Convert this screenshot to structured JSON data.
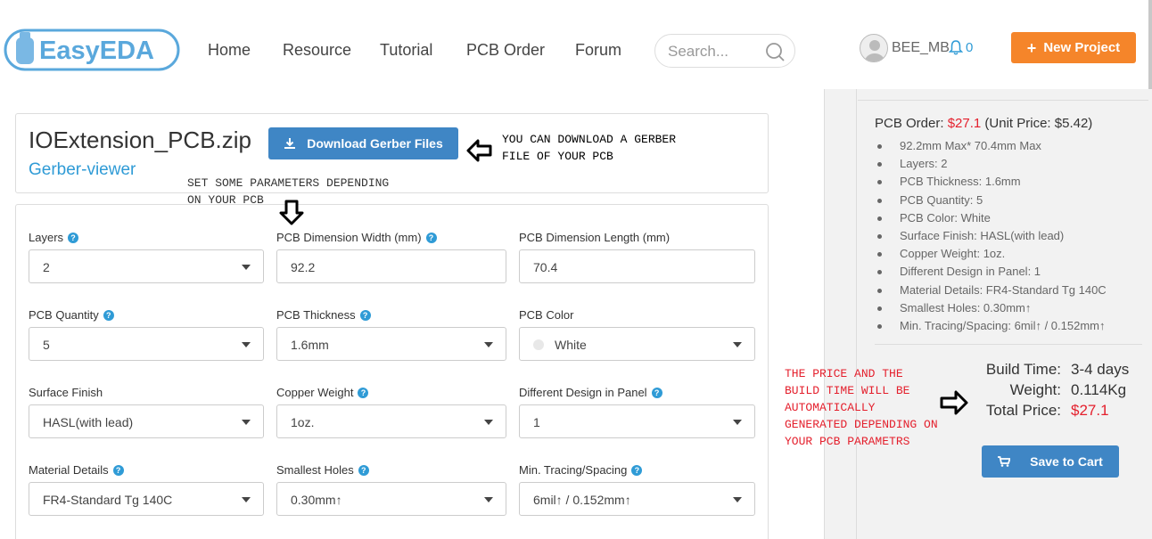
{
  "header": {
    "logo_text": "EasyEDA",
    "nav": [
      "Home",
      "Resource",
      "Tutorial",
      "PCB Order",
      "Forum"
    ],
    "search_placeholder": "Search...",
    "username": "BEE_MB",
    "notification_count": "0",
    "new_project_label": "New Project",
    "icons": [
      "search-icon",
      "bell-icon",
      "plus-icon",
      "avatar"
    ],
    "accent_color": "#f5852a",
    "brand_color": "#2f9bd6"
  },
  "file": {
    "title": "IOExtension_PCB.zip",
    "viewer_link": "Gerber-viewer",
    "download_label": "Download Gerber Files"
  },
  "annotations": {
    "download_note_1": "YOU CAN DOWNLOAD A GERBER",
    "download_note_2": "FILE OF YOUR PCB",
    "params_note_1": "SET SOME PARAMETERS DEPENDING",
    "params_note_2": "ON YOUR PCB",
    "price_note": [
      "THE PRICE AND THE",
      "BUILD TIME WILL BE",
      "AUTOMATICALLY",
      "GENERATED DEPENDING ON",
      "YOUR PCB PARAMETRS"
    ]
  },
  "form": {
    "fields": [
      {
        "label": "Layers",
        "value": "2",
        "help": true,
        "type": "select"
      },
      {
        "label": "PCB Dimension Width (mm)",
        "value": "92.2",
        "help": true,
        "type": "input"
      },
      {
        "label": "PCB Dimension Length (mm)",
        "value": "70.4",
        "help": false,
        "type": "input"
      },
      {
        "label": "PCB Quantity",
        "value": "5",
        "help": true,
        "type": "select"
      },
      {
        "label": "PCB Thickness",
        "value": "1.6mm",
        "help": true,
        "type": "select"
      },
      {
        "label": "PCB Color",
        "value": "White",
        "help": false,
        "type": "select"
      },
      {
        "label": "Surface Finish",
        "value": "HASL(with lead)",
        "help": false,
        "type": "select"
      },
      {
        "label": "Copper Weight",
        "value": "1oz.",
        "help": true,
        "type": "select"
      },
      {
        "label": "Different Design in Panel",
        "value": "1",
        "help": true,
        "type": "select"
      },
      {
        "label": "Material Details",
        "value": "FR4-Standard Tg 140C",
        "help": true,
        "type": "select"
      },
      {
        "label": "Smallest Holes",
        "value": "0.30mm↑",
        "help": true,
        "type": "select"
      },
      {
        "label": "Min. Tracing/Spacing",
        "value": "6mil↑ / 0.152mm↑",
        "help": true,
        "type": "select"
      }
    ]
  },
  "order": {
    "title_prefix": "PCB Order: ",
    "price": "$27.1",
    "unit_price": "(Unit Price: $5.42)",
    "specs": [
      "92.2mm Max* 70.4mm Max",
      "Layers: 2",
      "PCB Thickness: 1.6mm",
      "PCB Quantity: 5",
      "PCB Color: White",
      "Surface Finish: HASL(with lead)",
      "Copper Weight: 1oz.",
      "Different Design in Panel: 1",
      "Material Details: FR4-Standard Tg 140C",
      "Smallest Holes: 0.30mm↑",
      "Min. Tracing/Spacing: 6mil↑ / 0.152mm↑"
    ],
    "build_time_label": "Build Time:",
    "build_time": "3-4 days",
    "weight_label": "Weight:",
    "weight": "0.114Kg",
    "total_label": "Total Price:",
    "total": "$27.1",
    "cart_label": "Save to Cart"
  }
}
